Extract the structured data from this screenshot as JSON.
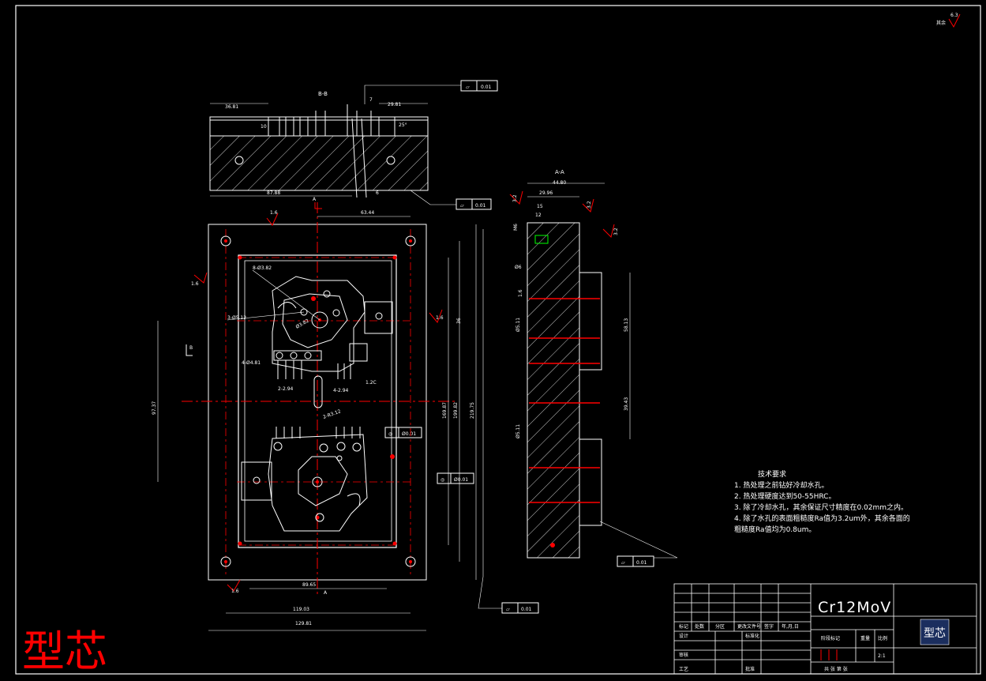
{
  "colors": {
    "background": "#000000",
    "lines": "#ffffff",
    "center": "#ff0000",
    "hatch": "#ffffff",
    "accent": "#ff0000",
    "leader": "#00ff00",
    "logo_bg": "#1b2e5e"
  },
  "title": {
    "part_name": "型芯",
    "material": "Cr12MoV",
    "scale": "2:1",
    "logo": "型芯"
  },
  "surface_finish": {
    "general": "6.3",
    "label": "其余"
  },
  "views": {
    "section_bb": "B-B",
    "section_aa": "A-A",
    "arrow_a": "A",
    "arrow_b": "B"
  },
  "tech_requirements": {
    "heading": "技术要求",
    "items": [
      "1. 热处理之前钻好冷却水孔。",
      "2. 热处理硬度达到50-55HRC。",
      "3. 除了冷却水孔，其余保证尺寸精度在0.02mm之内。",
      "4. 除了水孔的表面粗糙度Ra值为3.2um外，其余各面的",
      "粗糙度Ra值均为0.8um。"
    ]
  },
  "dimensions": {
    "bb_left": "36.81",
    "bb_right": "29.81",
    "bb_h": "10",
    "bb_top": "7",
    "bb_ang": "25°",
    "bb_bottom": "87.88",
    "bb_6": "6",
    "bb_12": "12",
    "plan_top": "63.44",
    "plan_w1": "89.65",
    "plan_w2": "119.03",
    "plan_w3": "129.81",
    "plan_h1": "169.87",
    "plan_h2": "199.82",
    "plan_h3": "219.75",
    "plan_h4": "97.37",
    "plan_36": "36",
    "plan_r1": "8-Ø3.82",
    "plan_r2": "3-Ø5.12",
    "plan_r3": "4-Ø4.81",
    "plan_r4": "2-2.94",
    "plan_r5": "4-2.94",
    "plan_r6": "1.2C",
    "plan_r7": "2-R3.12",
    "plan_r8": "Ø3.82",
    "aa_w": "44.80",
    "aa_29": "29.96",
    "aa_15": "15",
    "aa_12": "12",
    "aa_m6": "M6",
    "aa_6": "Ø6",
    "aa_16": "1.6",
    "aa_58": "58.13",
    "aa_39": "39.43",
    "aa_d1": "Ø5.11",
    "aa_d2": "Ø5.11",
    "ra_16": "1.6",
    "ra_32": "3.2"
  },
  "tolerance_frames": [
    {
      "symbol": "▱",
      "value": "0.01"
    },
    {
      "symbol": "▱",
      "value": "0.01"
    },
    {
      "symbol": "◎",
      "value": "Ø0.01"
    },
    {
      "symbol": "◎",
      "value": "Ø0.01"
    },
    {
      "symbol": "▱",
      "value": "0.01"
    },
    {
      "symbol": "▱",
      "value": "0.01"
    }
  ],
  "title_block": {
    "row_labels": [
      "标记",
      "处数",
      "分区",
      "更改文件号",
      "签字",
      "年,月,日"
    ],
    "design": "设计",
    "standard": "标准化",
    "check": "审核",
    "process": "工艺",
    "approve": "批准",
    "stage": "阶段标记",
    "weight": "重量",
    "ratio": "比例",
    "sheets": "共  张  第  张"
  }
}
